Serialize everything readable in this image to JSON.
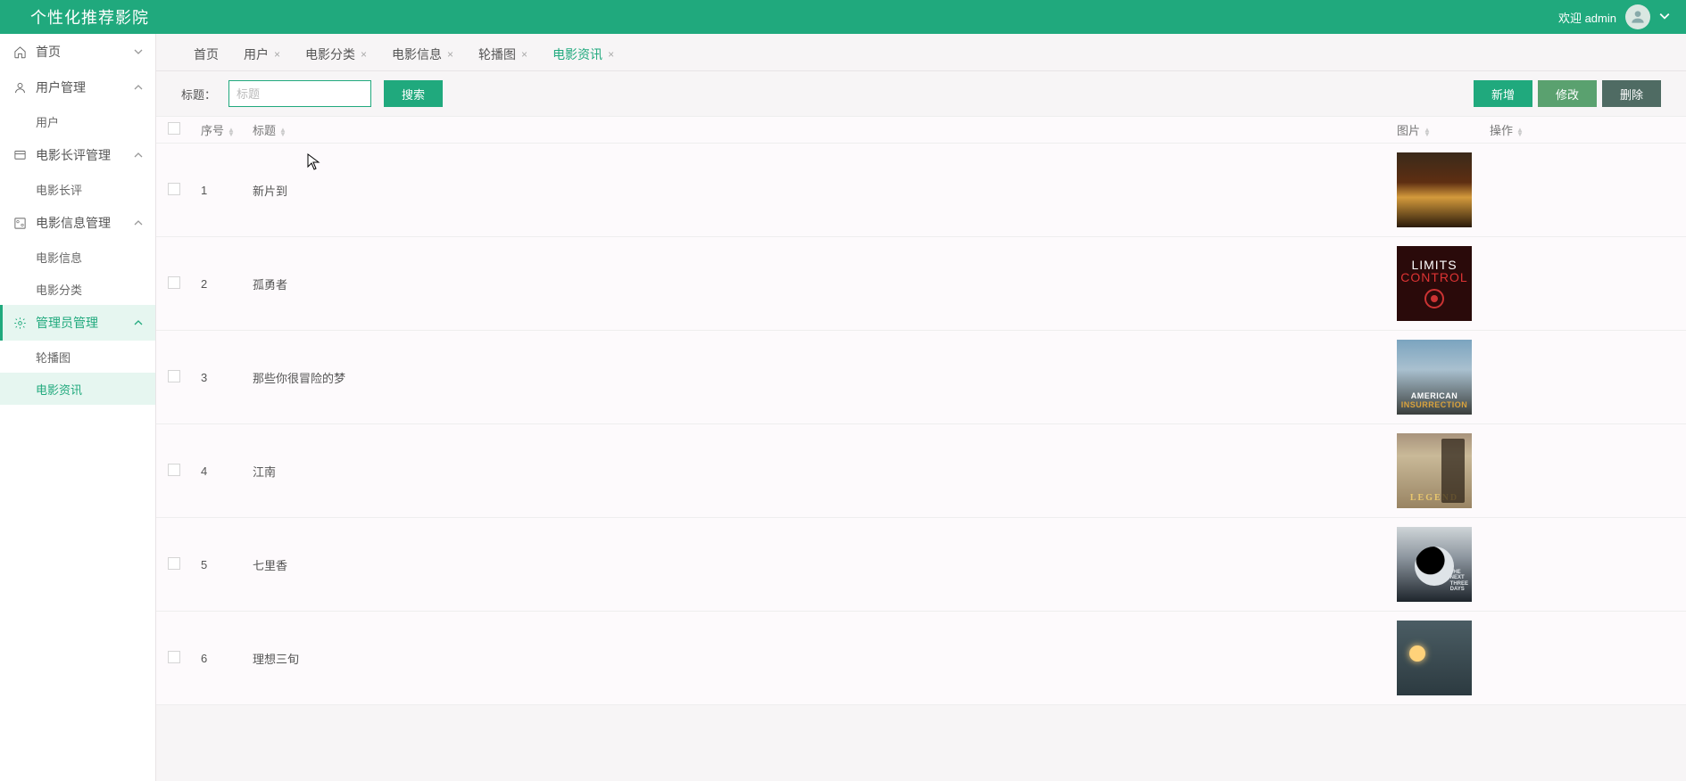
{
  "header": {
    "title": "个性化推荐影院",
    "welcome": "欢迎 admin"
  },
  "sidebar": {
    "home": "首页",
    "userMgmt": "用户管理",
    "user": "用户",
    "reviewMgmt": "电影长评管理",
    "review": "电影长评",
    "movieInfoMgmt": "电影信息管理",
    "movieInfo": "电影信息",
    "movieCat": "电影分类",
    "adminMgmt": "管理员管理",
    "carousel": "轮播图",
    "news": "电影资讯"
  },
  "tabs": [
    {
      "label": "首页",
      "closable": false,
      "active": false
    },
    {
      "label": "用户",
      "closable": true,
      "active": false
    },
    {
      "label": "电影分类",
      "closable": true,
      "active": false
    },
    {
      "label": "电影信息",
      "closable": true,
      "active": false
    },
    {
      "label": "轮播图",
      "closable": true,
      "active": false
    },
    {
      "label": "电影资讯",
      "closable": true,
      "active": true
    }
  ],
  "toolbar": {
    "titleLabel": "标题：",
    "searchPlaceholder": "标题",
    "searchBtn": "搜索",
    "addBtn": "新增",
    "editBtn": "修改",
    "delBtn": "删除"
  },
  "columns": {
    "index": "序号",
    "title": "标题",
    "image": "图片",
    "op": "操作"
  },
  "rows": [
    {
      "idx": "1",
      "title": "新片到",
      "poster": "p1"
    },
    {
      "idx": "2",
      "title": "孤勇者",
      "poster": "p2"
    },
    {
      "idx": "3",
      "title": "那些你很冒险的梦",
      "poster": "p3"
    },
    {
      "idx": "4",
      "title": "江南",
      "poster": "p4"
    },
    {
      "idx": "5",
      "title": "七里香",
      "poster": "p5"
    },
    {
      "idx": "6",
      "title": "理想三旬",
      "poster": "p6"
    }
  ],
  "posterText": {
    "p2a": "LIMITS",
    "p2b": "CONTROL",
    "p3a": "AMERICAN",
    "p3b": "INSURRECTION",
    "p4": "LEGEND",
    "p5": "THE NEXT THREE DAYS"
  }
}
